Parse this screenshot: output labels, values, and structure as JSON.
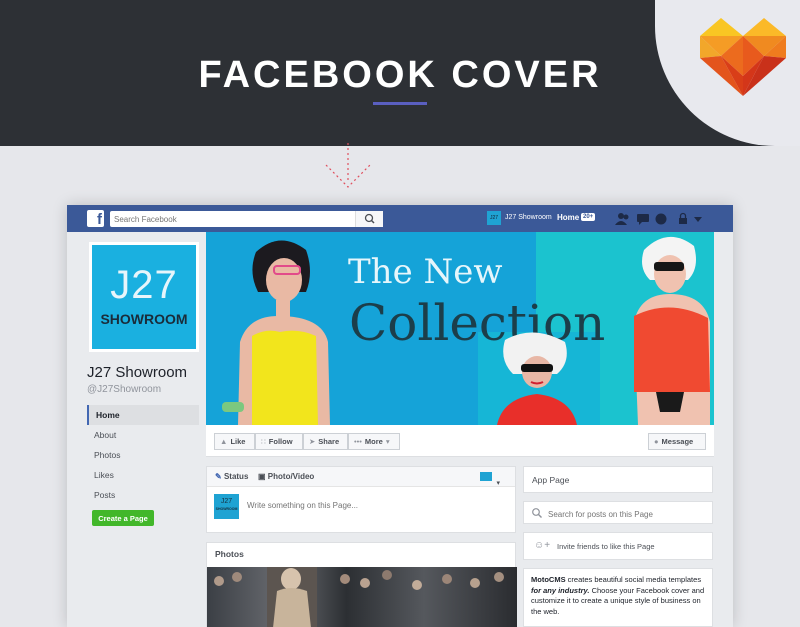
{
  "banner": {
    "title": "FACEBOOK COVER"
  },
  "colors": {
    "facebook_blue": "#3b5998",
    "cover_blue": "#15a3d8",
    "cover_cyan": "#1bc3cf",
    "create_green": "#42b72a",
    "dark_band": "#2d3035"
  },
  "topbar": {
    "search_placeholder": "Search Facebook",
    "page_name": "J27 Showroom",
    "home_label": "Home",
    "home_count": "20+",
    "avatar_text": "J27"
  },
  "profile": {
    "pic_line1": "J27",
    "pic_line2": "SHOWROOM",
    "name": "J27 Showroom",
    "handle": "@J27Showroom",
    "nav": [
      "Home",
      "About",
      "Photos",
      "Likes",
      "Posts"
    ],
    "create_page": "Create a Page"
  },
  "cover": {
    "line1": "The New",
    "line2": "Collection"
  },
  "actions": {
    "like": "Like",
    "follow": "Follow",
    "share": "Share",
    "more": "More",
    "message": "Message"
  },
  "composer": {
    "status": "Status",
    "photo_video": "Photo/Video",
    "avatar_line1": "J27",
    "avatar_line2": "SHOWROOM",
    "placeholder": "Write something on this Page..."
  },
  "photos": {
    "heading": "Photos"
  },
  "right": {
    "app_page": "App Page",
    "search_placeholder": "Search for posts on this Page",
    "invite": "Invite friends to like this Page",
    "about_bold": "MotoCMS",
    "about_text_1": " creates beautiful social media templates ",
    "about_italic": "for any industry.",
    "about_text_2": " Choose your Facebook cover and customize it to create a unique style of business on the web."
  }
}
